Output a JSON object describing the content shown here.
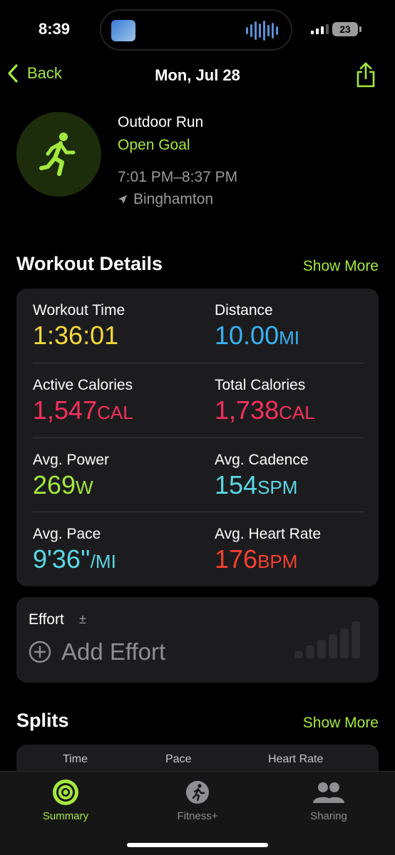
{
  "status": {
    "time": "8:39",
    "battery": "23"
  },
  "nav": {
    "back_label": "Back",
    "title": "Mon, Jul 28"
  },
  "workout": {
    "type": "Outdoor Run",
    "goal": "Open Goal",
    "time_range": "7:01 PM–8:37 PM",
    "location": "Binghamton"
  },
  "details": {
    "title": "Workout Details",
    "show_more": "Show More",
    "metrics": [
      {
        "label": "Workout Time",
        "value": "1:36:01",
        "unit": "",
        "color": "#f5d93b"
      },
      {
        "label": "Distance",
        "value": "10.00",
        "unit": "MI",
        "color": "#38b2f5"
      },
      {
        "label": "Active Calories",
        "value": "1,547",
        "unit": "CAL",
        "color": "#f5305e"
      },
      {
        "label": "Total Calories",
        "value": "1,738",
        "unit": "CAL",
        "color": "#f5305e"
      },
      {
        "label": "Avg. Power",
        "value": "269",
        "unit": "W",
        "color": "#a4e93f"
      },
      {
        "label": "Avg. Cadence",
        "value": "154",
        "unit": "SPM",
        "color": "#5ad8e6"
      },
      {
        "label": "Avg. Pace",
        "value": "9'36''",
        "unit": "/MI",
        "color": "#5ad8e6"
      },
      {
        "label": "Avg. Heart Rate",
        "value": "176",
        "unit": "BPM",
        "color": "#f5402f"
      }
    ]
  },
  "effort": {
    "label": "Effort",
    "plusminus": "±",
    "add_label": "Add Effort"
  },
  "splits": {
    "title": "Splits",
    "show_more": "Show More",
    "columns": [
      "Time",
      "Pace",
      "Heart Rate"
    ]
  },
  "tabs": [
    {
      "label": "Summary",
      "icon": "activity-rings-icon",
      "active": true
    },
    {
      "label": "Fitness+",
      "icon": "fitness-plus-icon",
      "active": false
    },
    {
      "label": "Sharing",
      "icon": "people-icon",
      "active": false
    }
  ],
  "colors": {
    "accent": "#a4e93f",
    "card": "#1c1c1e",
    "background": "#000000"
  }
}
